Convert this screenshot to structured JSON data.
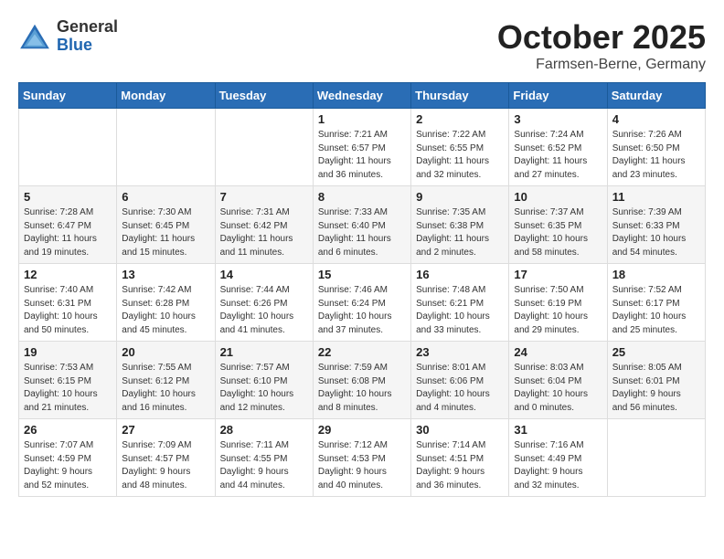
{
  "header": {
    "logo_general": "General",
    "logo_blue": "Blue",
    "month_title": "October 2025",
    "location": "Farmsen-Berne, Germany"
  },
  "weekdays": [
    "Sunday",
    "Monday",
    "Tuesday",
    "Wednesday",
    "Thursday",
    "Friday",
    "Saturday"
  ],
  "weeks": [
    [
      {
        "day": "",
        "info": ""
      },
      {
        "day": "",
        "info": ""
      },
      {
        "day": "",
        "info": ""
      },
      {
        "day": "1",
        "info": "Sunrise: 7:21 AM\nSunset: 6:57 PM\nDaylight: 11 hours\nand 36 minutes."
      },
      {
        "day": "2",
        "info": "Sunrise: 7:22 AM\nSunset: 6:55 PM\nDaylight: 11 hours\nand 32 minutes."
      },
      {
        "day": "3",
        "info": "Sunrise: 7:24 AM\nSunset: 6:52 PM\nDaylight: 11 hours\nand 27 minutes."
      },
      {
        "day": "4",
        "info": "Sunrise: 7:26 AM\nSunset: 6:50 PM\nDaylight: 11 hours\nand 23 minutes."
      }
    ],
    [
      {
        "day": "5",
        "info": "Sunrise: 7:28 AM\nSunset: 6:47 PM\nDaylight: 11 hours\nand 19 minutes."
      },
      {
        "day": "6",
        "info": "Sunrise: 7:30 AM\nSunset: 6:45 PM\nDaylight: 11 hours\nand 15 minutes."
      },
      {
        "day": "7",
        "info": "Sunrise: 7:31 AM\nSunset: 6:42 PM\nDaylight: 11 hours\nand 11 minutes."
      },
      {
        "day": "8",
        "info": "Sunrise: 7:33 AM\nSunset: 6:40 PM\nDaylight: 11 hours\nand 6 minutes."
      },
      {
        "day": "9",
        "info": "Sunrise: 7:35 AM\nSunset: 6:38 PM\nDaylight: 11 hours\nand 2 minutes."
      },
      {
        "day": "10",
        "info": "Sunrise: 7:37 AM\nSunset: 6:35 PM\nDaylight: 10 hours\nand 58 minutes."
      },
      {
        "day": "11",
        "info": "Sunrise: 7:39 AM\nSunset: 6:33 PM\nDaylight: 10 hours\nand 54 minutes."
      }
    ],
    [
      {
        "day": "12",
        "info": "Sunrise: 7:40 AM\nSunset: 6:31 PM\nDaylight: 10 hours\nand 50 minutes."
      },
      {
        "day": "13",
        "info": "Sunrise: 7:42 AM\nSunset: 6:28 PM\nDaylight: 10 hours\nand 45 minutes."
      },
      {
        "day": "14",
        "info": "Sunrise: 7:44 AM\nSunset: 6:26 PM\nDaylight: 10 hours\nand 41 minutes."
      },
      {
        "day": "15",
        "info": "Sunrise: 7:46 AM\nSunset: 6:24 PM\nDaylight: 10 hours\nand 37 minutes."
      },
      {
        "day": "16",
        "info": "Sunrise: 7:48 AM\nSunset: 6:21 PM\nDaylight: 10 hours\nand 33 minutes."
      },
      {
        "day": "17",
        "info": "Sunrise: 7:50 AM\nSunset: 6:19 PM\nDaylight: 10 hours\nand 29 minutes."
      },
      {
        "day": "18",
        "info": "Sunrise: 7:52 AM\nSunset: 6:17 PM\nDaylight: 10 hours\nand 25 minutes."
      }
    ],
    [
      {
        "day": "19",
        "info": "Sunrise: 7:53 AM\nSunset: 6:15 PM\nDaylight: 10 hours\nand 21 minutes."
      },
      {
        "day": "20",
        "info": "Sunrise: 7:55 AM\nSunset: 6:12 PM\nDaylight: 10 hours\nand 16 minutes."
      },
      {
        "day": "21",
        "info": "Sunrise: 7:57 AM\nSunset: 6:10 PM\nDaylight: 10 hours\nand 12 minutes."
      },
      {
        "day": "22",
        "info": "Sunrise: 7:59 AM\nSunset: 6:08 PM\nDaylight: 10 hours\nand 8 minutes."
      },
      {
        "day": "23",
        "info": "Sunrise: 8:01 AM\nSunset: 6:06 PM\nDaylight: 10 hours\nand 4 minutes."
      },
      {
        "day": "24",
        "info": "Sunrise: 8:03 AM\nSunset: 6:04 PM\nDaylight: 10 hours\nand 0 minutes."
      },
      {
        "day": "25",
        "info": "Sunrise: 8:05 AM\nSunset: 6:01 PM\nDaylight: 9 hours\nand 56 minutes."
      }
    ],
    [
      {
        "day": "26",
        "info": "Sunrise: 7:07 AM\nSunset: 4:59 PM\nDaylight: 9 hours\nand 52 minutes."
      },
      {
        "day": "27",
        "info": "Sunrise: 7:09 AM\nSunset: 4:57 PM\nDaylight: 9 hours\nand 48 minutes."
      },
      {
        "day": "28",
        "info": "Sunrise: 7:11 AM\nSunset: 4:55 PM\nDaylight: 9 hours\nand 44 minutes."
      },
      {
        "day": "29",
        "info": "Sunrise: 7:12 AM\nSunset: 4:53 PM\nDaylight: 9 hours\nand 40 minutes."
      },
      {
        "day": "30",
        "info": "Sunrise: 7:14 AM\nSunset: 4:51 PM\nDaylight: 9 hours\nand 36 minutes."
      },
      {
        "day": "31",
        "info": "Sunrise: 7:16 AM\nSunset: 4:49 PM\nDaylight: 9 hours\nand 32 minutes."
      },
      {
        "day": "",
        "info": ""
      }
    ]
  ]
}
